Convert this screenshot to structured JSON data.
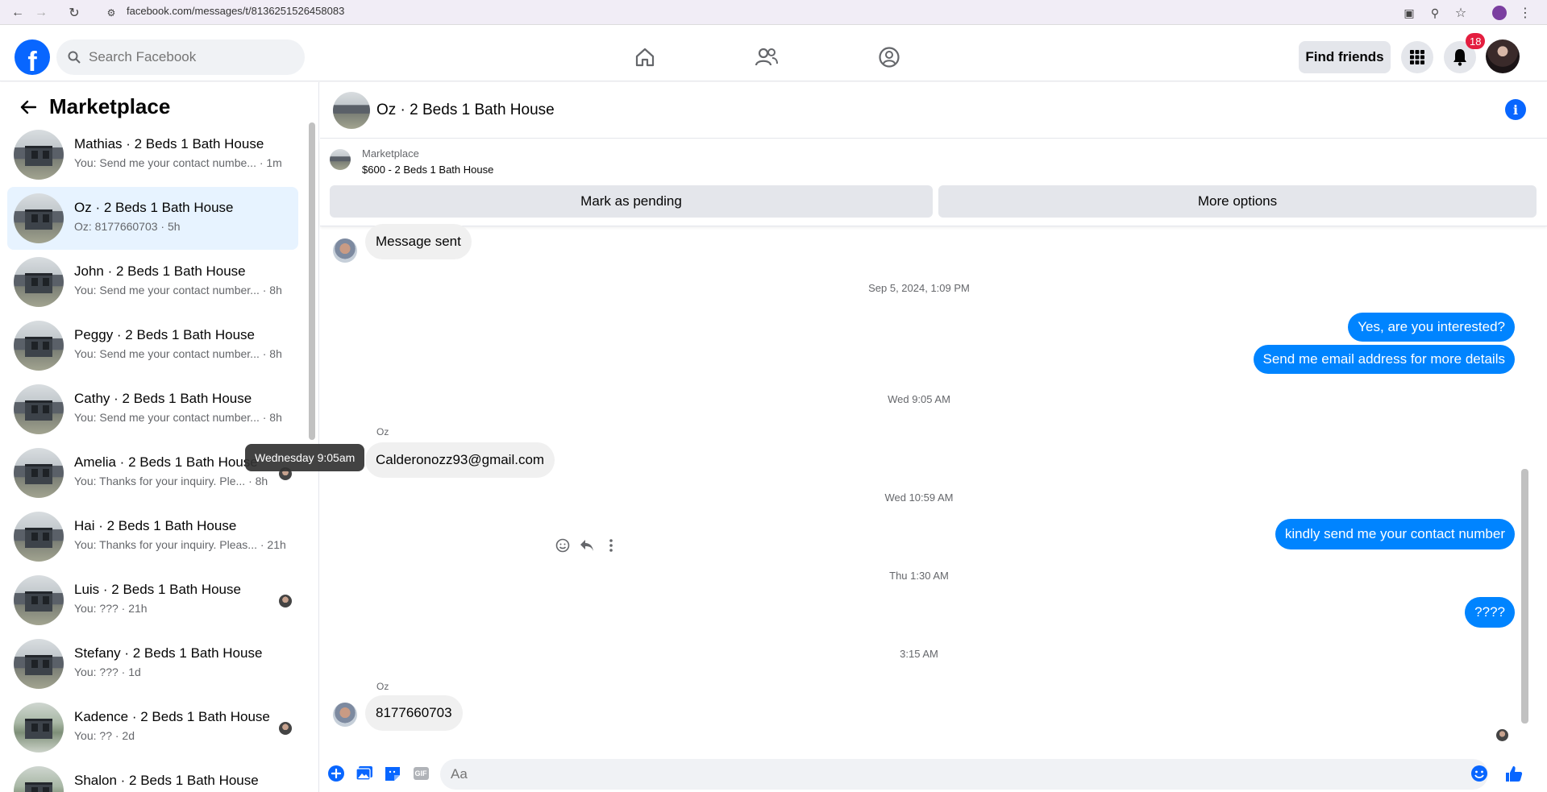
{
  "browser": {
    "url": "facebook.com/messages/t/8136251526458083"
  },
  "topnav": {
    "search_placeholder": "Search Facebook",
    "find_friends": "Find friends",
    "notification_count": "18"
  },
  "sidebar": {
    "title": "Marketplace",
    "conversations": [
      {
        "name": "Mathias · 2 Beds 1 Bath House",
        "preview": "You: Send me your contact numbe... · 1m"
      },
      {
        "name": "Oz · 2 Beds 1 Bath House",
        "preview": "Oz: 8177660703 · 5h"
      },
      {
        "name": "John · 2 Beds 1 Bath House",
        "preview": "You: Send me your contact number... · 8h"
      },
      {
        "name": "Peggy · 2 Beds 1 Bath House",
        "preview": "You: Send me your contact number... · 8h"
      },
      {
        "name": "Cathy · 2 Beds 1 Bath House",
        "preview": "You: Send me your contact number... · 8h"
      },
      {
        "name": "Amelia · 2 Beds 1 Bath House",
        "preview": "You: Thanks for your inquiry. Ple... · 8h"
      },
      {
        "name": "Hai · 2 Beds 1 Bath House",
        "preview": "You: Thanks for your inquiry. Pleas... · 21h"
      },
      {
        "name": "Luis · 2 Beds 1 Bath House",
        "preview": "You: ??? · 21h"
      },
      {
        "name": "Stefany · 2 Beds 1 Bath House",
        "preview": "You: ??? · 1d"
      },
      {
        "name": "Kadence · 2 Beds 1 Bath House",
        "preview": "You: ?? · 2d"
      },
      {
        "name": "Shalon · 2 Beds 1 Bath House",
        "preview": ""
      }
    ],
    "tooltip": "Wednesday 9:05am"
  },
  "chat": {
    "title": "Oz · 2 Beds 1 Bath House",
    "listing_source": "Marketplace",
    "listing_title": "$600 - 2 Beds 1 Bath House",
    "mark_pending": "Mark as pending",
    "more_options": "More options",
    "messages": {
      "m1": "Message sent",
      "stamp1": "Sep 5, 2024, 1:09 PM",
      "m2": "Yes, are you interested?",
      "m3": "Send me email address for more details",
      "stamp2": "Wed 9:05 AM",
      "sender1": "Oz",
      "m4": "Calderonozz93@gmail.com",
      "stamp3": "Wed 10:59 AM",
      "m5": "kindly send me your contact number",
      "stamp4": "Thu 1:30 AM",
      "m6": "????",
      "stamp5": "3:15 AM",
      "sender2": "Oz",
      "m7": "8177660703"
    },
    "composer_placeholder": "Aa"
  },
  "colors": {
    "brand": "#0866ff",
    "outgoing_bubble": "#0084ff",
    "active_conversation": "#e7f3ff",
    "badge": "#e41e3f"
  }
}
